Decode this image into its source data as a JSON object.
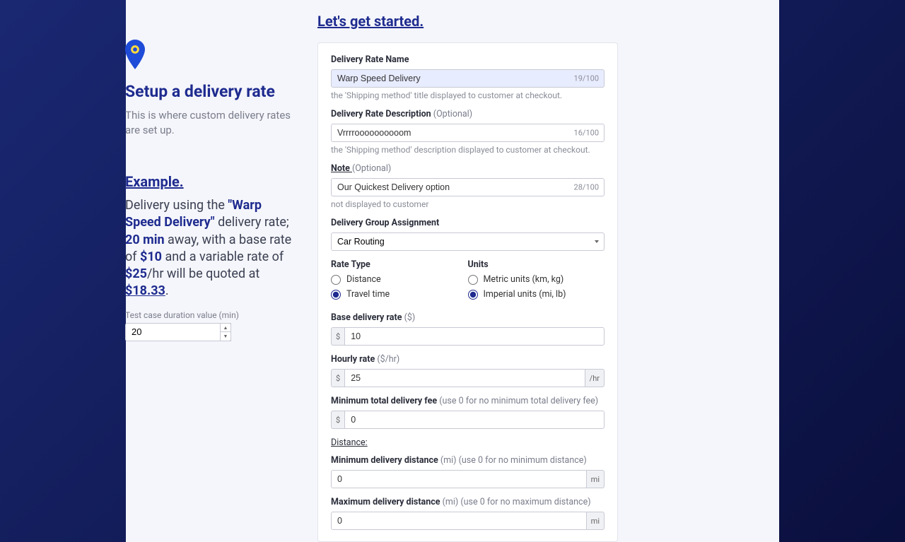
{
  "header": {
    "title": "Let's get started."
  },
  "sidebar": {
    "title": "Setup a delivery rate",
    "desc": "This is where custom delivery rates are set up.",
    "example_heading": "Example.",
    "ex": {
      "p1": "Delivery using the ",
      "p2": "\"Warp Speed Delivery\"",
      "p3": " delivery rate; ",
      "p4": "20 min",
      "p5": " away, with a base rate of ",
      "p6": "$10",
      "p7": " and a variable rate of ",
      "p8": "$25",
      "p9": "/hr will be quoted at ",
      "p10": "$18.33",
      "p11": "."
    },
    "test_label": "Test case duration value (min)",
    "test_value": "20"
  },
  "form": {
    "name": {
      "label": "Delivery Rate Name",
      "value": "Warp Speed Delivery",
      "counter": "19/100",
      "helper": "the 'Shipping method' title displayed to customer at checkout."
    },
    "desc": {
      "label": "Delivery Rate Description ",
      "opt": "(Optional)",
      "value": "Vrrrroooooooooom",
      "counter": "16/100",
      "helper": "the 'Shipping method' description displayed to customer at checkout."
    },
    "note": {
      "label": "Note ",
      "opt": "(Optional)",
      "value": "Our Quickest Delivery option",
      "counter": "28/100",
      "helper": "not displayed to customer"
    },
    "group": {
      "label": "Delivery Group Assignment",
      "value": "Car Routing"
    },
    "rate_type": {
      "label": "Rate Type",
      "opt1": "Distance",
      "opt2": "Travel time"
    },
    "units": {
      "label": "Units",
      "opt1": "Metric units (km, kg)",
      "opt2": "Imperial units (mi, lb)"
    },
    "base": {
      "label": "Base delivery rate ",
      "unit": "($)",
      "prefix": "$",
      "value": "10"
    },
    "hourly": {
      "label": "Hourly rate ",
      "unit": "($/hr)",
      "prefix": "$",
      "value": "25",
      "suffix": "/hr"
    },
    "minfee": {
      "label": "Minimum total delivery fee ",
      "hint": "(use 0 for no minimum total delivery fee)",
      "prefix": "$",
      "value": "0"
    },
    "dist_heading": "Distance:",
    "mindist": {
      "label": "Minimum delivery distance ",
      "unit": "(mi) ",
      "hint": "(use 0 for no minimum distance)",
      "value": "0",
      "suffix": "mi"
    },
    "maxdist": {
      "label": "Maximum delivery distance ",
      "unit": "(mi) ",
      "hint": "(use 0 for no maximum distance)",
      "value": "0",
      "suffix": "mi"
    }
  }
}
